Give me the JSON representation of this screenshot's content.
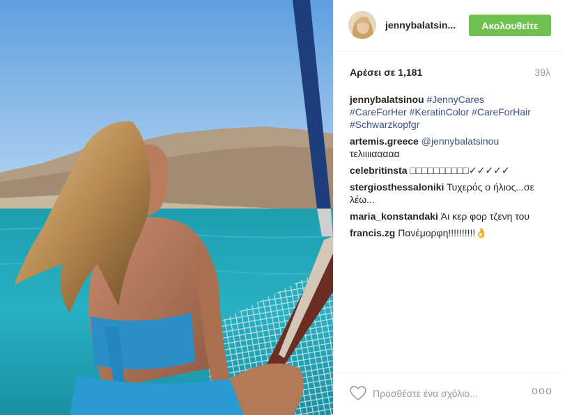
{
  "header": {
    "username": "jennybalatsin...",
    "follow_label": "Ακολουθείτε"
  },
  "stats": {
    "likes": "Αρέσει σε 1,181",
    "time": "39λ"
  },
  "comments": [
    {
      "user": "jennybalatsinou",
      "text": "",
      "tags": [
        "#JennyCares",
        "#CareForHer",
        "#KeratinColor",
        "#CareForHair",
        "#Schwarzkopfgr"
      ]
    },
    {
      "user": "artemis.greece",
      "mention": "@jennybalatsinou",
      "text": "τελιιιιααααα"
    },
    {
      "user": "celebritinsta",
      "text": "□□□□□□□□□□✓✓✓✓✓"
    },
    {
      "user": "stergiosthessaloniki",
      "text": "Τυχερός ο ήλιος...σε λέω..."
    },
    {
      "user": "maria_konstandaki",
      "text": "Άι κερ φορ τζενη του"
    },
    {
      "user": "francis.zg",
      "text": "Πανέμορφη!!!!!!!!!!👌"
    }
  ],
  "footer": {
    "placeholder": "Προσθέστε ένα σχόλιο...",
    "more_label": "ooo"
  },
  "colors": {
    "follow_button": "#70c050",
    "hashtag": "#385185",
    "muted": "#999999"
  },
  "icons": {
    "like": "heart-icon",
    "options": "more-options-icon"
  }
}
